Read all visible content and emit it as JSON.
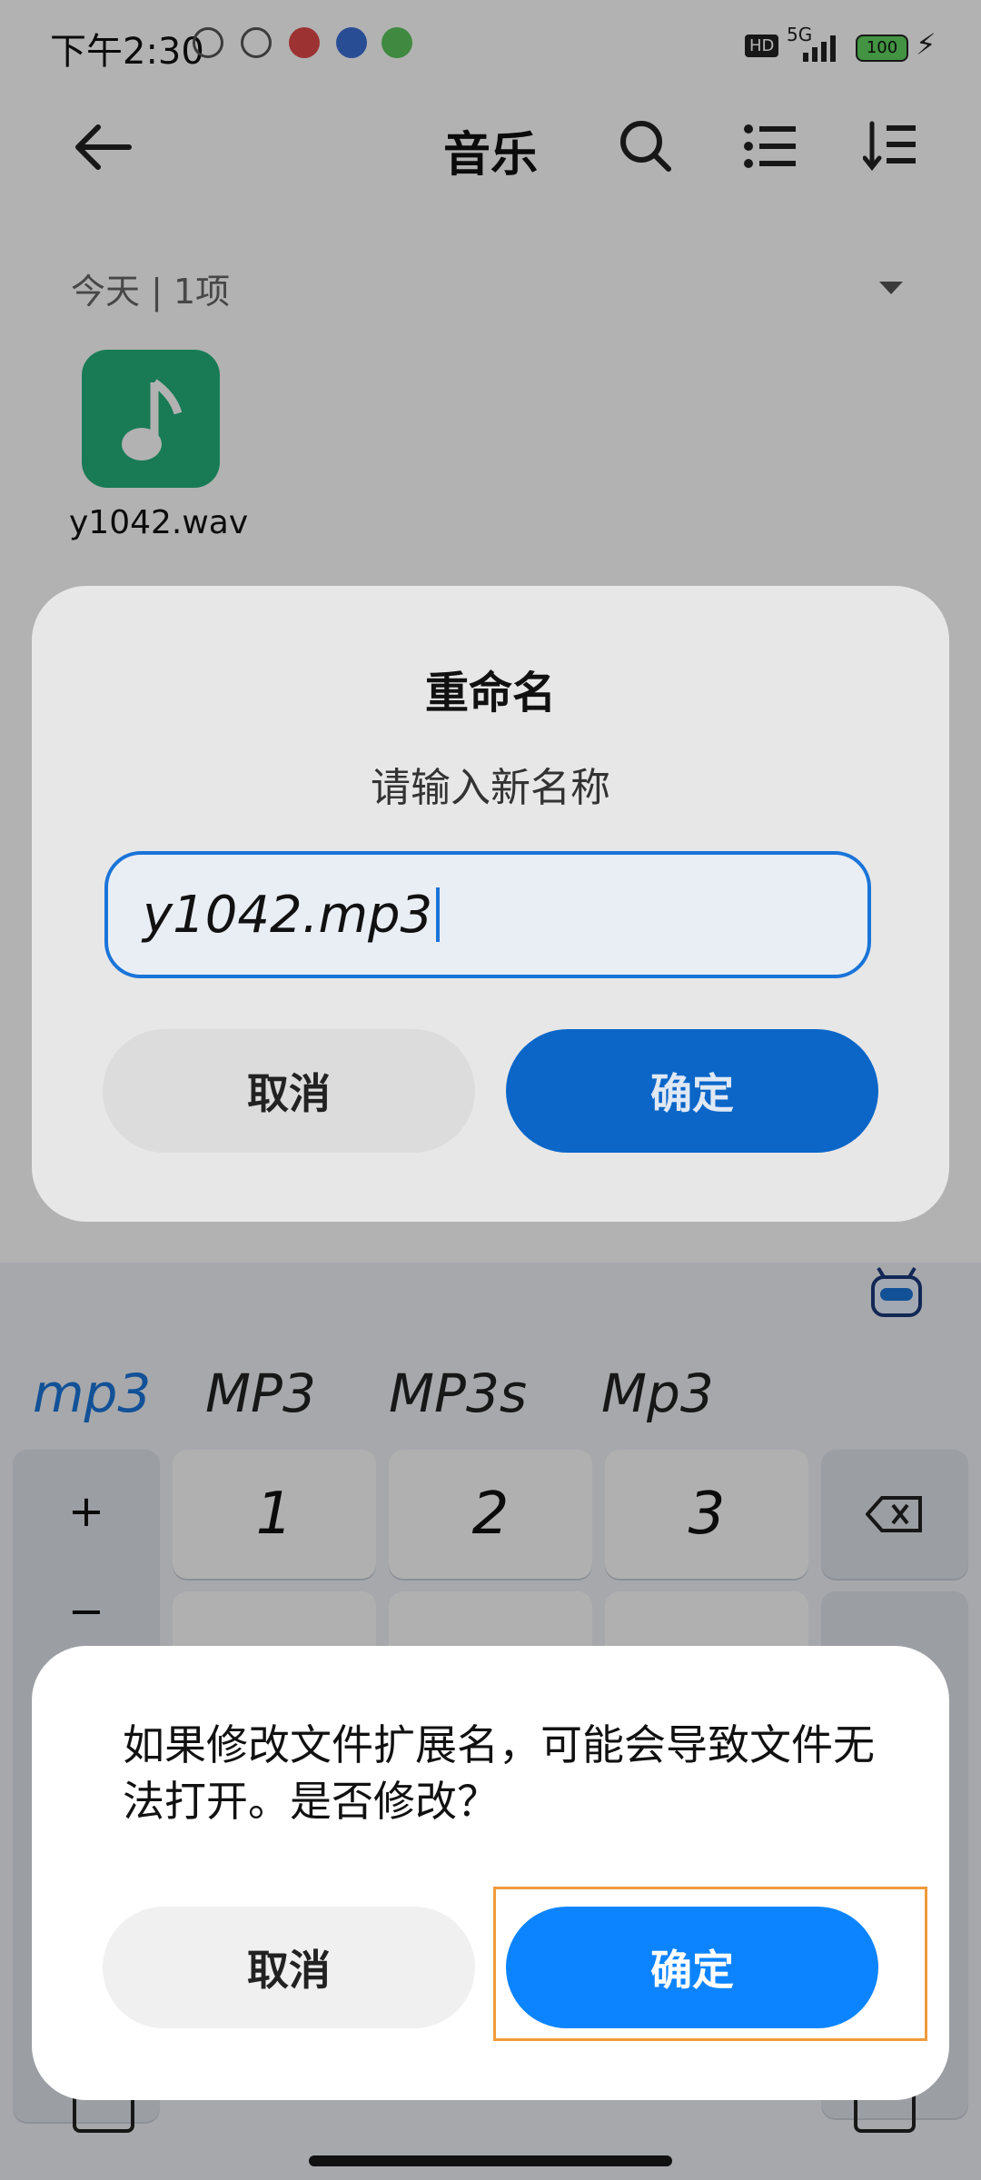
{
  "status_bar": {
    "time": "下午2:30",
    "network": "5G",
    "battery": "100"
  },
  "app_bar": {
    "title": "音乐"
  },
  "section": {
    "label": "今天 | 1项"
  },
  "file": {
    "name": "y1042.wav"
  },
  "rename_dialog": {
    "title": "重命名",
    "subtitle": "请输入新名称",
    "input_value": "y1042.mp3",
    "cancel_label": "取消",
    "confirm_label": "确定"
  },
  "keyboard": {
    "suggestions": [
      "mp3",
      "MP3",
      "MP3s",
      "Mp3"
    ],
    "keys": {
      "k1": "1",
      "k2": "2",
      "k3": "3",
      "plus": "+",
      "minus": "−"
    }
  },
  "warning_dialog": {
    "message": "如果修改文件扩展名，可能会导致文件无法打开。是否修改？",
    "cancel_label": "取消",
    "confirm_label": "确定"
  },
  "colors": {
    "primary": "#0d84ff",
    "accent_dark": "#1a74d8",
    "file_icon": "#24b07a",
    "highlight": "#f09a3c"
  }
}
